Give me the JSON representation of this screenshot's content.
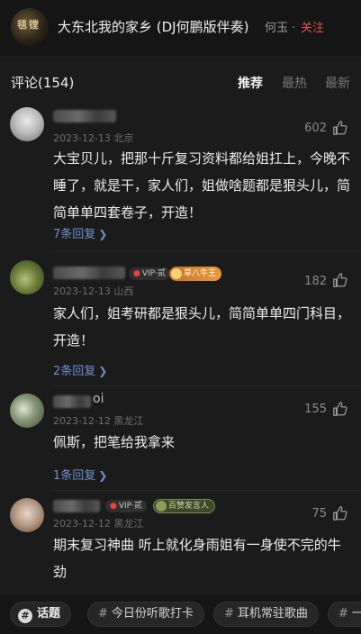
{
  "header": {
    "song_title": "大东北我的家乡 (DJ何鹏版伴奏)",
    "artist": "何玉",
    "separator": "·",
    "follow_label": "关注",
    "album_glyph": "毯 镗"
  },
  "comments_header": {
    "title": "评论(154)",
    "tabs": [
      {
        "label": "推荐",
        "active": true
      },
      {
        "label": "最热",
        "active": false
      },
      {
        "label": "最新",
        "active": false
      }
    ]
  },
  "comments": [
    {
      "date_location": "2023-12-13 北京",
      "likes": "602",
      "text": "大宝贝儿，把那十斤复习资料都给姐扛上，今晚不睡了，就是干，家人们，姐做啥题都是狠头儿，简简单单四套卷子，开造！",
      "replies": "7条回复"
    },
    {
      "date_location": "2023-12-13 山西",
      "likes": "182",
      "text": "家人们，姐考研都是狠头儿，简简单单四门科目，开造！",
      "replies": "2条回复",
      "badges": {
        "vip": "VIP·贰",
        "gold": "草八牛王"
      }
    },
    {
      "name_fragment": "oi",
      "date_location": "2023-12-12 黑龙江",
      "likes": "155",
      "text": "佩斯，把笔给我拿来",
      "replies": "1条回复"
    },
    {
      "date_location": "2023-12-12 黑龙江",
      "likes": "75",
      "text": "期末复习神曲 听上就化身雨姐有一身使不完的牛劲",
      "badges": {
        "vip": "VIP·贰",
        "green": "百赞发言人"
      }
    }
  ],
  "topics": [
    {
      "label": "话题",
      "main": true
    },
    {
      "label": "今日份听歌打卡"
    },
    {
      "label": "耳机常驻歌曲"
    },
    {
      "label": "一"
    }
  ],
  "colors": {
    "accent": "#e0534e",
    "link": "#6f8fd0",
    "background": "#1b1b1b"
  }
}
